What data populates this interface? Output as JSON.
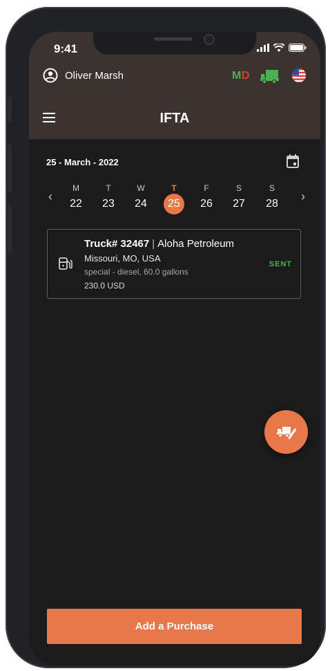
{
  "status_bar": {
    "time": "9:41"
  },
  "header": {
    "user_name": "Oliver Marsh",
    "state_code_first": "M",
    "state_code_second": "D",
    "title": "IFTA"
  },
  "calendar": {
    "date_label": "25 - March - 2022",
    "days": [
      {
        "letter": "M",
        "number": "22"
      },
      {
        "letter": "T",
        "number": "23"
      },
      {
        "letter": "W",
        "number": "24"
      },
      {
        "letter": "T",
        "number": "25",
        "selected": true
      },
      {
        "letter": "F",
        "number": "26"
      },
      {
        "letter": "S",
        "number": "27"
      },
      {
        "letter": "S",
        "number": "28"
      }
    ]
  },
  "purchase": {
    "truck": "Truck# 32467",
    "separator": "|",
    "vendor": "Aloha Petroleum",
    "location": "Missouri, MO, USA",
    "fuel": "special - diesel, 60.0 gallons",
    "amount": "230.0 USD",
    "status": "SENT"
  },
  "actions": {
    "add_purchase": "Add a Purchase"
  },
  "icons": {
    "account": "account-circle-icon",
    "truck": "truck-icon",
    "flag": "us-flag-icon",
    "menu": "hamburger-menu-icon",
    "calendar": "calendar-icon",
    "fuel_pump": "fuel-pump-icon",
    "fab": "truck-edit-icon"
  },
  "colors": {
    "accent": "#e8774a",
    "header_bg": "#3b3330",
    "screen_bg": "#1b1b1b",
    "status_sent": "#4caf50",
    "state_m": "#4caf50",
    "state_d": "#e53935"
  }
}
